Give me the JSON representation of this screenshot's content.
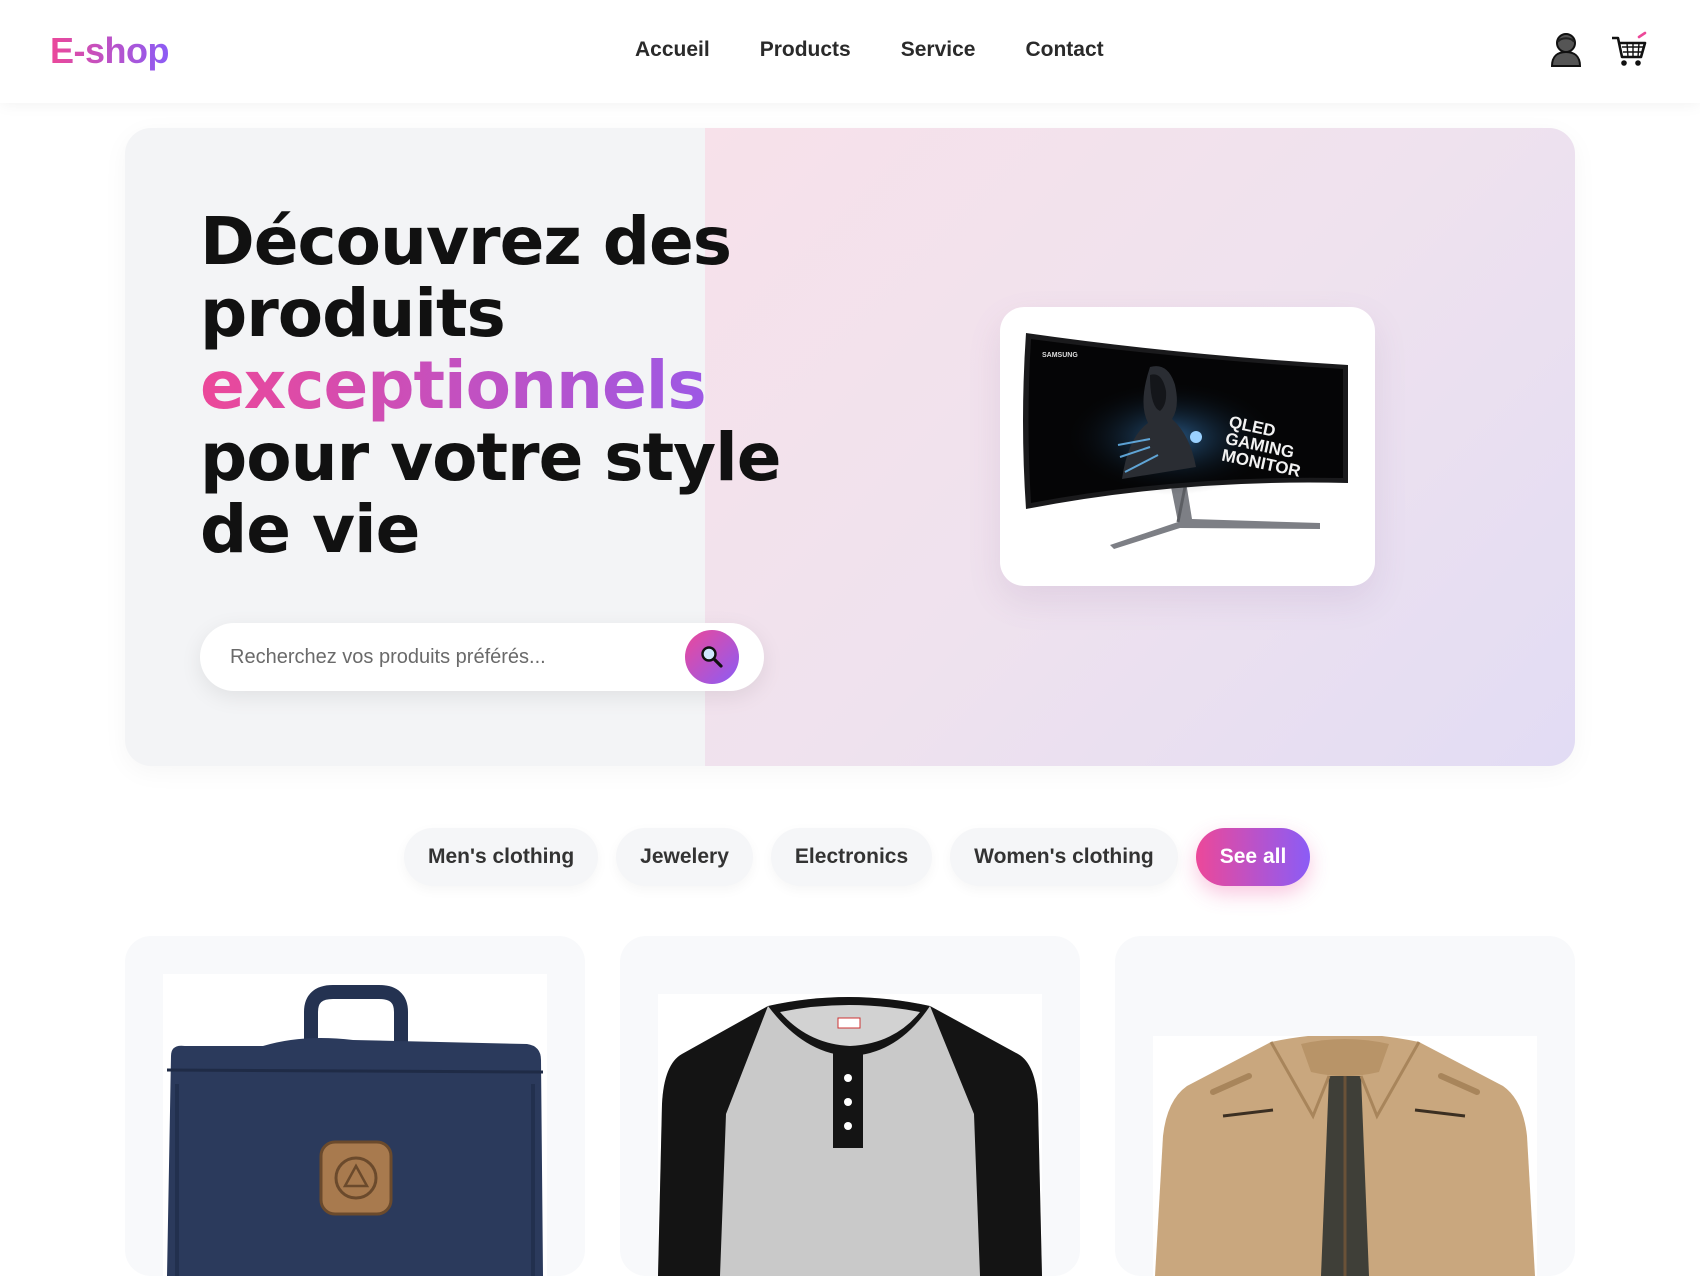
{
  "header": {
    "logo": "E-shop",
    "nav": [
      {
        "label": "Accueil"
      },
      {
        "label": "Products"
      },
      {
        "label": "Service"
      },
      {
        "label": "Contact"
      }
    ],
    "icons": [
      "user-icon",
      "cart-icon"
    ]
  },
  "hero": {
    "title_line1": "Découvrez des",
    "title_line2": "produits",
    "title_highlight": "exceptionnels",
    "title_line4": "pour votre style",
    "title_line5": "de vie",
    "search_placeholder": "Recherchez vos produits préférés...",
    "featured_product": {
      "brand": "SAMSUNG",
      "caption": [
        "QLED",
        "GAMING",
        "MONITOR"
      ]
    }
  },
  "categories": [
    {
      "label": "Men's clothing",
      "active": false
    },
    {
      "label": "Jewelery",
      "active": false
    },
    {
      "label": "Electronics",
      "active": false
    },
    {
      "label": "Women's clothing",
      "active": false
    },
    {
      "label": "See all",
      "active": true
    }
  ],
  "products": [
    {
      "image": "backpack"
    },
    {
      "image": "henley-shirt"
    },
    {
      "image": "jacket"
    }
  ],
  "colors": {
    "accent_start": "#ec4899",
    "accent_end": "#8b5cf6",
    "text": "#111111"
  }
}
